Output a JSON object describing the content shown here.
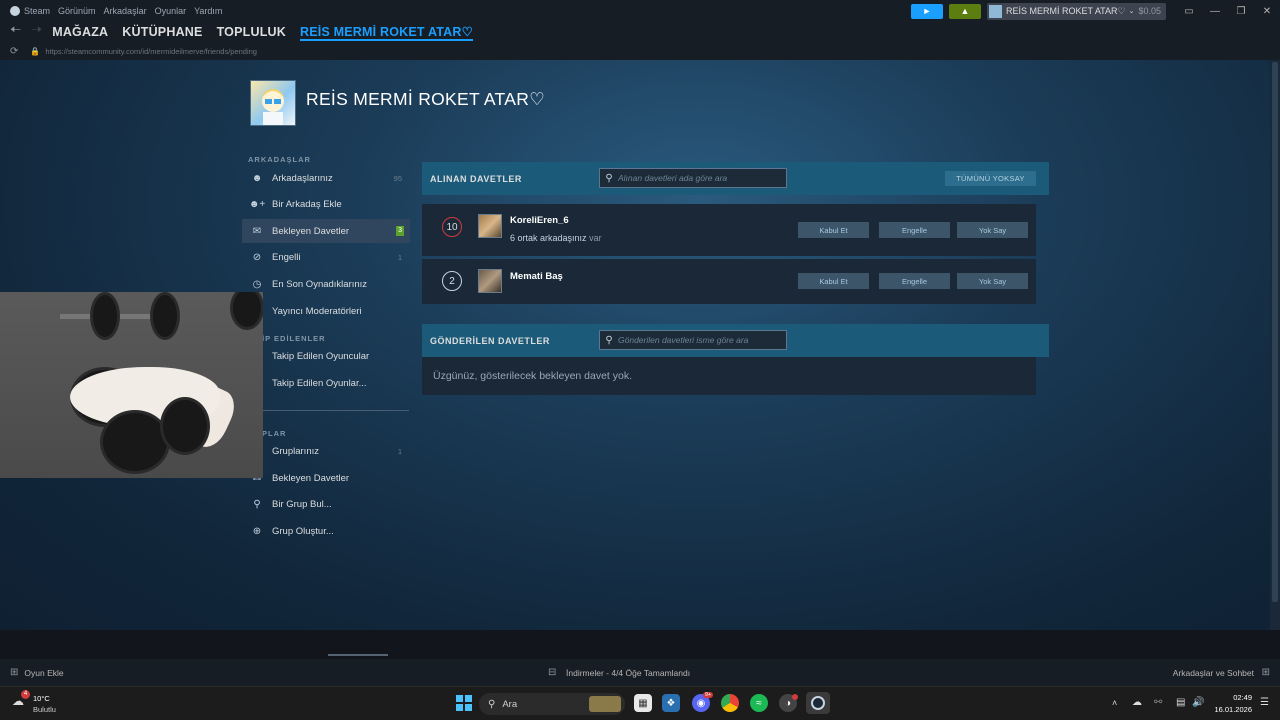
{
  "menu": {
    "items": [
      "Steam",
      "Görünüm",
      "Arkadaşlar",
      "Oyunlar",
      "Yardım"
    ]
  },
  "account": {
    "name": "REİS MERMİ ROKET ATAR♡",
    "wallet": "$0.05"
  },
  "nav": {
    "tabs": [
      "MAĞAZA",
      "KÜTÜPHANE",
      "TOPLULUK",
      "REİS MERMİ ROKET ATAR♡"
    ]
  },
  "url": "https://steamcommunity.com/id/mermideilmerve/friends/pending",
  "profile": {
    "name": "REİS MERMİ ROKET ATAR♡"
  },
  "sidebar": {
    "friends_title": "ARKADAŞLAR",
    "items": [
      {
        "label": "Arkadaşlarınız",
        "count": "95",
        "icon": "user-icon"
      },
      {
        "label": "Bir Arkadaş Ekle",
        "count": "",
        "icon": "add-user-icon"
      },
      {
        "label": "Bekleyen Davetler",
        "count": "3",
        "icon": "mail-icon"
      },
      {
        "label": "Engelli",
        "count": "1",
        "icon": "block-icon"
      },
      {
        "label": "En Son Oynadıklarınız",
        "count": "",
        "icon": "clock-icon"
      },
      {
        "label": "Yayıncı Moderatörleri",
        "count": "",
        "icon": "broadcast-icon"
      }
    ],
    "following_title": "İP EDİLENLER",
    "following_items": [
      {
        "label": "Takip Edilen Oyuncular"
      },
      {
        "label": "Takip Edilen Oyunlar..."
      }
    ],
    "groups_title": "PLAR",
    "group_items": [
      {
        "label": "Gruplarınız",
        "count": "1",
        "icon": "group-icon"
      },
      {
        "label": "Bekleyen Davetler",
        "count": "",
        "icon": "mail-icon"
      },
      {
        "label": "Bir Grup Bul...",
        "count": "",
        "icon": "search-icon"
      },
      {
        "label": "Grup Oluştur...",
        "count": "",
        "icon": "plus-circle-icon"
      }
    ]
  },
  "received": {
    "title": "ALINAN DAVETLER",
    "search_placeholder": "Alınan davetleri ada göre ara",
    "ignore_all": "TÜMÜNÜ YOKSAY",
    "invites": [
      {
        "level": "10",
        "name": "KoreliEren_6",
        "mutual": "6 ortak arkadaşınız",
        "mutual_suffix": "var"
      },
      {
        "level": "2",
        "name": "Memati Baş",
        "mutual": "",
        "mutual_suffix": ""
      }
    ],
    "accept": "Kabul Et",
    "block": "Engelle",
    "ignore": "Yok Say"
  },
  "sent": {
    "title": "GÖNDERİLEN DAVETLER",
    "search_placeholder": "Gönderilen davetleri isme göre ara",
    "empty": "Üzgünüz, gösterilecek bekleyen davet yok."
  },
  "footer": {
    "add_game": "Oyun Ekle",
    "downloads": "İndirmeler - 4/4 Öğe Tamamlandı",
    "friends_chat": "Arkadaşlar ve Sohbet"
  },
  "taskbar": {
    "weather_temp": "10°C",
    "weather_desc": "Bulutlu",
    "weather_badge": "4",
    "search": "Ara",
    "time": "02:49",
    "date": "16.01.2026",
    "discord_badge": "9+"
  },
  "colors": {
    "accent": "#1a9fff",
    "panel_header": "#1b5a78",
    "online_badge": "#5ba32b"
  }
}
